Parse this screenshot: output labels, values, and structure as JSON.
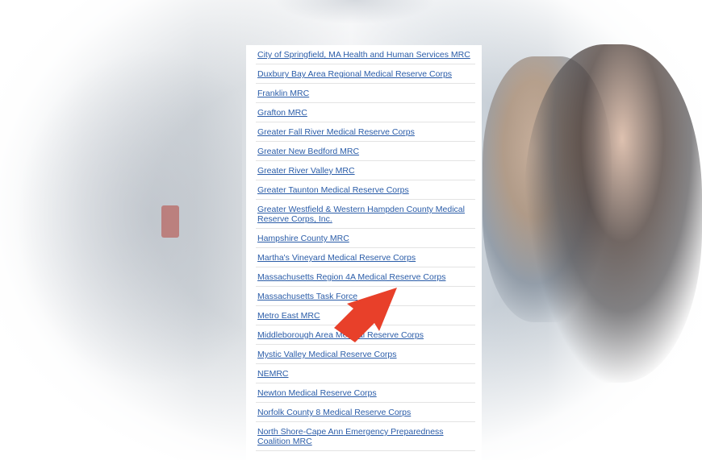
{
  "mrc_list": {
    "items": [
      "City of Springfield, MA Health and Human Services MRC",
      "Duxbury Bay Area Regional Medical Reserve Corps",
      "Franklin MRC",
      "Grafton MRC",
      "Greater Fall River Medical Reserve Corps",
      "Greater New Bedford MRC",
      "Greater River Valley MRC",
      "Greater Taunton Medical Reserve Corps",
      "Greater Westfield & Western Hampden County Medical Reserve Corps, Inc.",
      "Hampshire County MRC",
      "Martha's Vineyard Medical Reserve Corps",
      "Massachusetts Region 4A Medical Reserve Corps",
      "Massachusetts Task Force",
      "Metro East MRC",
      "Middleborough Area Medical Reserve Corps",
      "Mystic Valley Medical Reserve Corps",
      "NEMRC",
      "Newton Medical Reserve Corps",
      "Norfolk County 8 Medical Reserve Corps",
      "North Shore-Cape Ann Emergency Preparedness Coalition MRC"
    ]
  },
  "colors": {
    "link": "#2a5ca8",
    "arrow": "#e8402a"
  },
  "icons": {
    "highlight_arrow": "red-arrow-icon"
  }
}
